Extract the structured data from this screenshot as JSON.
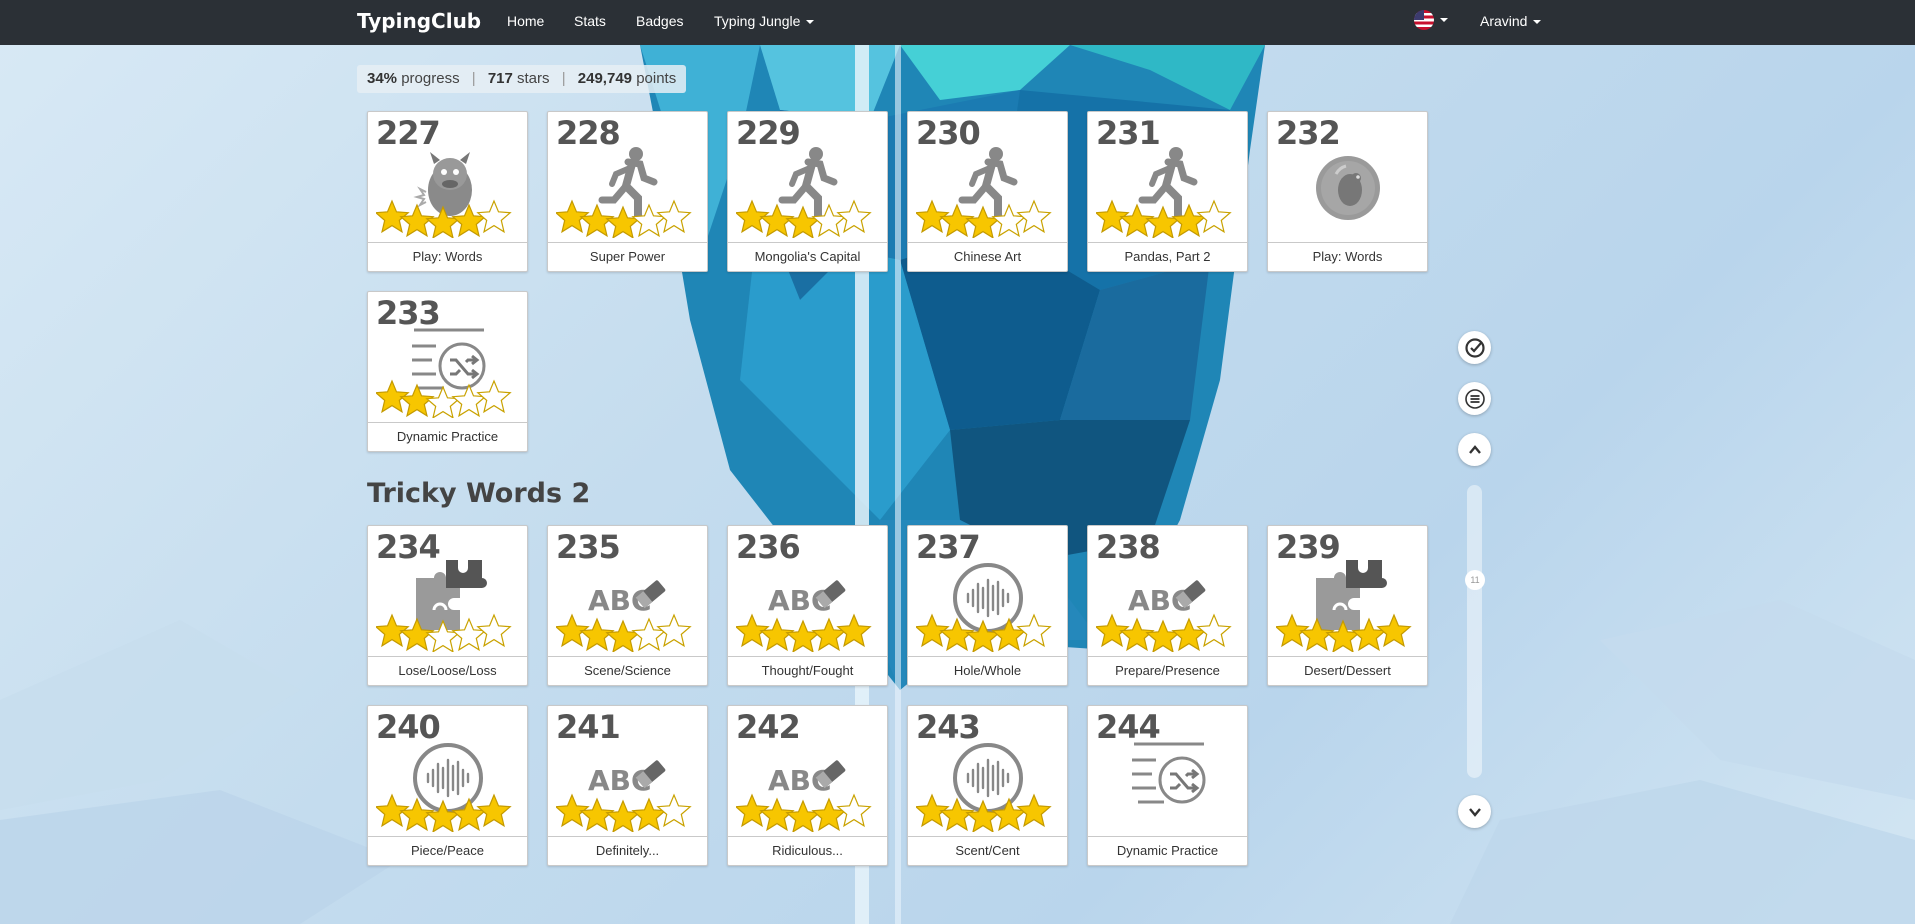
{
  "navbar": {
    "brand": "TypingClub",
    "links": [
      "Home",
      "Stats",
      "Badges"
    ],
    "course_menu": "Typing Jungle",
    "user": "Aravind",
    "language_flag": "us-flag-icon"
  },
  "progress": {
    "percent": "34%",
    "percent_label": "progress",
    "stars": "717",
    "stars_label": "stars",
    "points": "249,749",
    "points_label": "points"
  },
  "section": {
    "title": "Tricky Words 2"
  },
  "lessons": [
    {
      "num": "227",
      "label": "Play: Words",
      "icon": "monster-icon",
      "stars": 4
    },
    {
      "num": "228",
      "label": "Super Power",
      "icon": "runner-icon",
      "stars": 3
    },
    {
      "num": "229",
      "label": "Mongolia's Capital",
      "icon": "runner-icon",
      "stars": 3
    },
    {
      "num": "230",
      "label": "Chinese Art",
      "icon": "runner-icon",
      "stars": 3
    },
    {
      "num": "231",
      "label": "Pandas, Part 2",
      "icon": "runner-icon",
      "stars": 4
    },
    {
      "num": "232",
      "label": "Play: Words",
      "icon": "game-bubble-icon",
      "stars": 0
    },
    {
      "num": "233",
      "label": "Dynamic Practice",
      "icon": "shuffle-list-icon",
      "stars": 2
    },
    {
      "num": "234",
      "label": "Lose/Loose/Loss",
      "icon": "puzzle-icon",
      "stars": 2
    },
    {
      "num": "235",
      "label": "Scene/Science",
      "icon": "abc-eraser-icon",
      "stars": 3
    },
    {
      "num": "236",
      "label": "Thought/Fought",
      "icon": "abc-eraser-icon",
      "stars": 5
    },
    {
      "num": "237",
      "label": "Hole/Whole",
      "icon": "audio-wave-icon",
      "stars": 4
    },
    {
      "num": "238",
      "label": "Prepare/Presence",
      "icon": "abc-eraser-icon",
      "stars": 4
    },
    {
      "num": "239",
      "label": "Desert/Dessert",
      "icon": "puzzle-icon",
      "stars": 5
    },
    {
      "num": "240",
      "label": "Piece/Peace",
      "icon": "audio-wave-icon",
      "stars": 5
    },
    {
      "num": "241",
      "label": "Definitely...",
      "icon": "abc-eraser-icon",
      "stars": 4
    },
    {
      "num": "242",
      "label": "Ridiculous...",
      "icon": "abc-eraser-icon",
      "stars": 4
    },
    {
      "num": "243",
      "label": "Scent/Cent",
      "icon": "audio-wave-icon",
      "stars": 5
    },
    {
      "num": "244",
      "label": "Dynamic Practice",
      "icon": "shuffle-list-icon",
      "stars": 0
    }
  ],
  "side_controls": {
    "scroll_label": "11",
    "buttons": [
      "check-circle-icon",
      "menu-icon",
      "chevron-up-icon",
      "chevron-down-icon"
    ]
  },
  "colors": {
    "star_fill": "#f7c600",
    "star_empty": "#ffffff",
    "navbar": "#2b3036",
    "accent_ice": "#2a8fc0"
  }
}
